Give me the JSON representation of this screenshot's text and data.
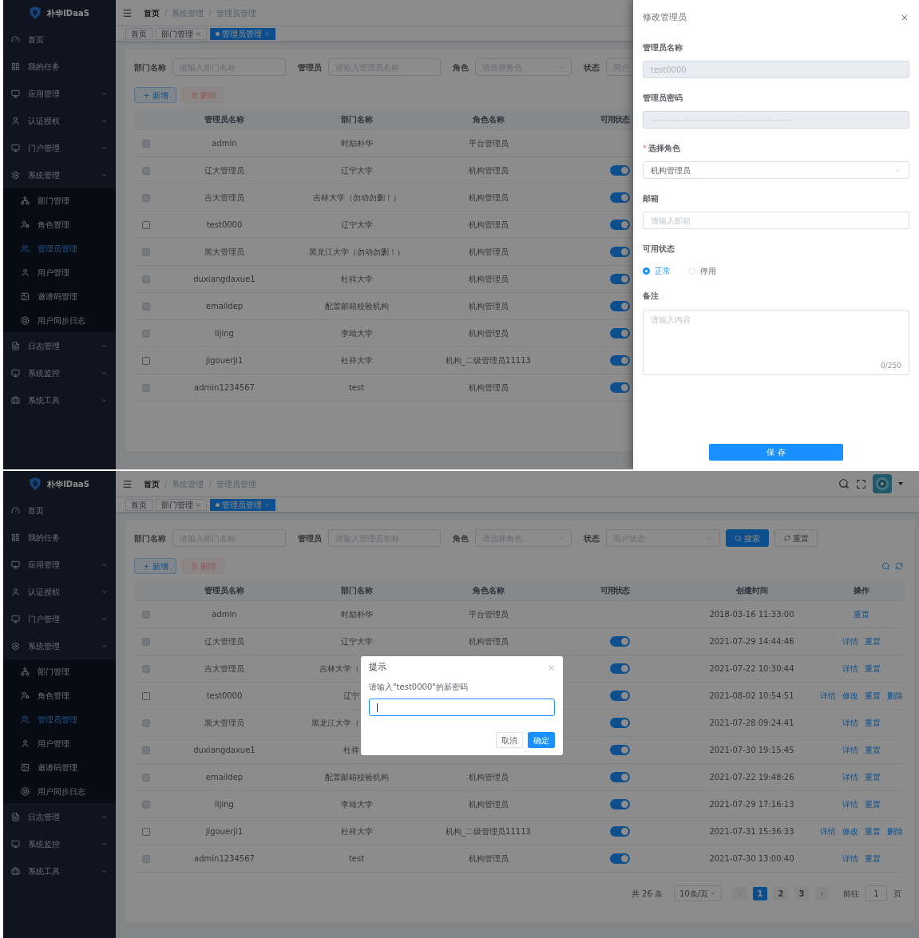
{
  "screens": [
    {
      "sidebar": {
        "brand": "朴华IDaaS",
        "items": [
          {
            "kind": "link",
            "label": "首页"
          },
          {
            "kind": "link",
            "label": "我的任务"
          },
          {
            "kind": "group",
            "label": "应用管理",
            "expanded": false
          },
          {
            "kind": "group",
            "label": "认证授权",
            "expanded": false
          },
          {
            "kind": "group",
            "label": "门户管理",
            "expanded": false
          },
          {
            "kind": "group",
            "label": "系统管理",
            "expanded": true,
            "children": [
              {
                "label": "部门管理",
                "selected": false
              },
              {
                "label": "角色管理",
                "selected": false
              },
              {
                "label": "管理员管理",
                "selected": true
              },
              {
                "label": "用户管理",
                "selected": false
              },
              {
                "label": "邀请码管理",
                "selected": false
              },
              {
                "label": "用户同步日志",
                "selected": false
              }
            ]
          },
          {
            "kind": "group",
            "label": "日志管理",
            "expanded": false
          },
          {
            "kind": "group",
            "label": "系统监控",
            "expanded": false
          },
          {
            "kind": "group",
            "label": "系统工具",
            "expanded": false
          }
        ]
      },
      "breadcrumb": [
        "首页",
        "系统管理",
        "管理员管理"
      ],
      "breadcrumb_separator": "/",
      "tabs": [
        {
          "label": "首页",
          "closable": false,
          "selected": false
        },
        {
          "label": "部门管理",
          "closable": true,
          "selected": false
        },
        {
          "label": "管理员管理",
          "closable": true,
          "selected": true
        }
      ],
      "filters": [
        {
          "label": "部门名称",
          "kind": "input",
          "placeholder": "请输入部门名称"
        },
        {
          "label": "管理员",
          "kind": "input",
          "placeholder": "请输入管理员名称"
        },
        {
          "label": "角色",
          "kind": "select",
          "placeholder": "请选择角色"
        },
        {
          "label": "状态",
          "kind": "input",
          "placeholder": "用户"
        }
      ],
      "actions": [
        {
          "label": "新增",
          "kind": "add",
          "disabled": false
        },
        {
          "label": "删除",
          "kind": "delete",
          "disabled": true
        }
      ],
      "columns": [
        {
          "label": "管理员名称",
          "kind": "text"
        },
        {
          "label": "部门名称",
          "kind": "text"
        },
        {
          "label": "角色名称",
          "kind": "text"
        },
        {
          "label": "可用状态",
          "kind": "switch"
        }
      ],
      "rows": [
        {
          "disabled": true,
          "cells": [
            "admin",
            "时励朴华",
            "平台管理员",
            null
          ]
        },
        {
          "disabled": true,
          "cells": [
            "辽大管理员",
            "辽宁大学",
            "机构管理员",
            {
              "on": true
            }
          ]
        },
        {
          "disabled": true,
          "cells": [
            "吉大管理员",
            "吉林大学（勿动勿删！）",
            "机构管理员",
            {
              "on": true
            }
          ]
        },
        {
          "disabled": false,
          "cells": [
            "test0000",
            "辽宁大学",
            "机构管理员",
            {
              "on": true
            }
          ]
        },
        {
          "disabled": true,
          "cells": [
            "黑大管理员",
            "黑龙江大学（勿动勿删！）",
            "机构管理员",
            {
              "on": true
            }
          ]
        },
        {
          "disabled": true,
          "cells": [
            "duxiangdaxue1",
            "杜祥大学",
            "机构管理员",
            {
              "on": true
            }
          ]
        },
        {
          "disabled": true,
          "cells": [
            "emaildep",
            "配置邮箱校验机构",
            "机构管理员",
            {
              "on": true
            }
          ]
        },
        {
          "disabled": true,
          "cells": [
            "lijing",
            "李靖大学",
            "机构管理员",
            {
              "on": true
            }
          ]
        },
        {
          "disabled": false,
          "cells": [
            "jigouerji1",
            "杜祥大学",
            "机构_二级管理员11113",
            {
              "on": true
            }
          ]
        },
        {
          "disabled": true,
          "cells": [
            "admin1234567",
            "test",
            "机构管理员",
            {
              "on": true
            }
          ]
        }
      ],
      "drawer": {
        "title": "修改管理员",
        "fields": [
          {
            "label": "管理员名称",
            "kind": "input",
            "disabled": true,
            "value": "test0000"
          },
          {
            "label": "管理员密码",
            "kind": "input",
            "disabled": true,
            "value": "·······················································"
          },
          {
            "label": "选择角色",
            "kind": "select",
            "required_mark": "*",
            "disabled": false,
            "value": "机构管理员"
          },
          {
            "label": "邮箱",
            "kind": "input",
            "disabled": false,
            "placeholder": "请输入邮箱"
          },
          {
            "label": "可用状态",
            "kind": "radio",
            "options": [
              {
                "label": "正常",
                "selected": true
              },
              {
                "label": "停用",
                "selected": false
              }
            ]
          },
          {
            "label": "备注",
            "kind": "textarea",
            "placeholder": "请输入内容",
            "counter": "0/250"
          }
        ],
        "submit": "保 存"
      }
    },
    {
      "sidebar": {
        "brand": "朴华IDaaS",
        "items": [
          {
            "kind": "link",
            "label": "首页"
          },
          {
            "kind": "link",
            "label": "我的任务"
          },
          {
            "kind": "group",
            "label": "应用管理",
            "expanded": false
          },
          {
            "kind": "group",
            "label": "认证授权",
            "expanded": false
          },
          {
            "kind": "group",
            "label": "门户管理",
            "expanded": false
          },
          {
            "kind": "group",
            "label": "系统管理",
            "expanded": true,
            "children": [
              {
                "label": "部门管理",
                "selected": false
              },
              {
                "label": "角色管理",
                "selected": false
              },
              {
                "label": "管理员管理",
                "selected": true
              },
              {
                "label": "用户管理",
                "selected": false
              },
              {
                "label": "邀请码管理",
                "selected": false
              },
              {
                "label": "用户同步日志",
                "selected": false
              }
            ]
          },
          {
            "kind": "group",
            "label": "日志管理",
            "expanded": false
          },
          {
            "kind": "group",
            "label": "系统监控",
            "expanded": false
          },
          {
            "kind": "group",
            "label": "系统工具",
            "expanded": false
          }
        ]
      },
      "breadcrumb": [
        "首页",
        "系统管理",
        "管理员管理"
      ],
      "breadcrumb_separator": "/",
      "header_tools": true,
      "tabs": [
        {
          "label": "首页",
          "closable": false,
          "selected": false
        },
        {
          "label": "部门管理",
          "closable": true,
          "selected": false
        },
        {
          "label": "管理员管理",
          "closable": true,
          "selected": true
        }
      ],
      "filters": [
        {
          "label": "部门名称",
          "kind": "input",
          "placeholder": "请输入部门名称"
        },
        {
          "label": "管理员",
          "kind": "input",
          "placeholder": "请输入管理员名称"
        },
        {
          "label": "角色",
          "kind": "select",
          "placeholder": "请选择角色"
        },
        {
          "label": "状态",
          "kind": "select",
          "placeholder": "用户状态"
        }
      ],
      "search_buttons": [
        {
          "label": "搜索",
          "kind": "primary"
        },
        {
          "label": "重置",
          "kind": "default"
        }
      ],
      "actions": [
        {
          "label": "新增",
          "kind": "add",
          "disabled": false
        },
        {
          "label": "删除",
          "kind": "delete",
          "disabled": true
        }
      ],
      "table_tools": true,
      "columns": [
        {
          "label": "管理员名称",
          "kind": "text"
        },
        {
          "label": "部门名称",
          "kind": "text"
        },
        {
          "label": "角色名称",
          "kind": "text"
        },
        {
          "label": "可用状态",
          "kind": "switch"
        },
        {
          "label": "创建时间",
          "kind": "text"
        },
        {
          "label": "操作",
          "kind": "actions"
        }
      ],
      "rows": [
        {
          "disabled": true,
          "cells": [
            "admin",
            "时励朴华",
            "平台管理员",
            null,
            "2018-03-16 11:33:00",
            [
              "重置"
            ]
          ]
        },
        {
          "disabled": true,
          "cells": [
            "辽大管理员",
            "辽宁大学",
            "机构管理员",
            {
              "on": true
            },
            "2021-07-29 14:44:46",
            [
              "详情",
              "重置"
            ]
          ]
        },
        {
          "disabled": true,
          "cells": [
            "吉大管理员",
            {
              "text": "吉林大学（",
              "cut": true
            },
            null,
            {
              "on": true
            },
            "2021-07-22 10:30:44",
            [
              "详情",
              "重置"
            ]
          ]
        },
        {
          "disabled": false,
          "cells": [
            "test0000",
            {
              "text": "辽宁",
              "cut": true
            },
            null,
            {
              "on": true
            },
            "2021-08-02 10:54:51",
            [
              "详情",
              "修改",
              "重置",
              "删除"
            ]
          ]
        },
        {
          "disabled": true,
          "cells": [
            "黑大管理员",
            {
              "text": "黑龙江大学（",
              "cut": true
            },
            null,
            {
              "on": true
            },
            "2021-07-28 09:24:41",
            [
              "详情",
              "重置"
            ]
          ]
        },
        {
          "disabled": true,
          "cells": [
            "duxiangdaxue1",
            {
              "text": "杜祥",
              "cut": true
            },
            null,
            {
              "on": true
            },
            "2021-07-30 19:15:45",
            [
              "详情",
              "重置"
            ]
          ]
        },
        {
          "disabled": true,
          "cells": [
            "emaildep",
            "配置邮箱校验机构",
            "机构管理员",
            {
              "on": true
            },
            "2021-07-22 19:48:26",
            [
              "详情",
              "重置"
            ]
          ]
        },
        {
          "disabled": true,
          "cells": [
            "lijing",
            "李靖大学",
            "机构管理员",
            {
              "on": true
            },
            "2021-07-29 17:16:13",
            [
              "详情",
              "重置"
            ]
          ]
        },
        {
          "disabled": false,
          "cells": [
            "jigouerji1",
            "杜祥大学",
            "机构_二级管理员11113",
            {
              "on": true
            },
            "2021-07-31 15:36:33",
            [
              "详情",
              "修改",
              "重置",
              "删除"
            ]
          ]
        },
        {
          "disabled": true,
          "cells": [
            "admin1234567",
            "test",
            "机构管理员",
            {
              "on": true
            },
            "2021-07-30 13:00:40",
            [
              "详情",
              "重置"
            ]
          ]
        }
      ],
      "pagination": {
        "total": "共 26 条",
        "page_size": "10条/页",
        "pages": [
          {
            "label": "1",
            "selected": true
          },
          {
            "label": "2",
            "selected": false
          },
          {
            "label": "3",
            "selected": false
          }
        ],
        "goto_label": "前往",
        "goto_value": "1",
        "page_unit": "页"
      },
      "dialog": {
        "title": "提示",
        "message": "请输入\"test0000\"的新密码",
        "input_focused": true,
        "buttons": [
          {
            "label": "取消",
            "kind": "default"
          },
          {
            "label": "确定",
            "kind": "primary"
          }
        ]
      }
    }
  ]
}
